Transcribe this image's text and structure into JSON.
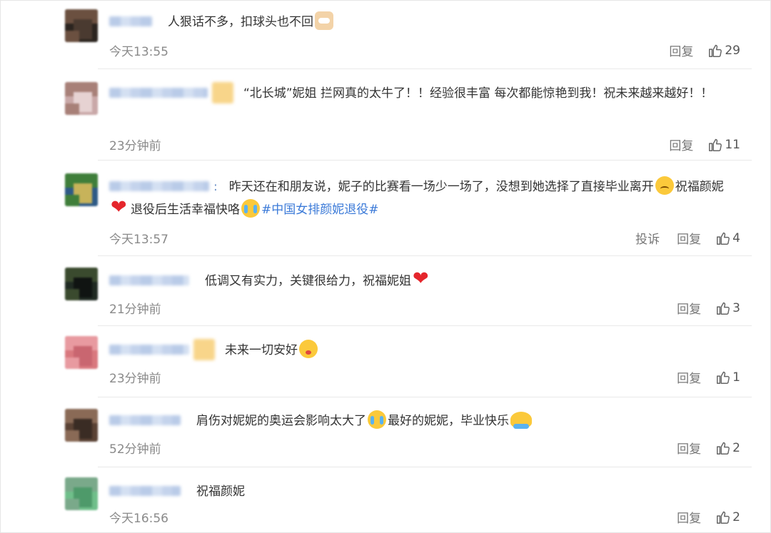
{
  "comments": [
    {
      "segments": [
        {
          "t": "人狠话不多，扣球头也不回"
        },
        {
          "emoji": "cat-face"
        }
      ],
      "badge": false,
      "colon": false,
      "time": "今天13:55",
      "report": null,
      "reply": "回复",
      "likes": "29",
      "avatar_colors": [
        "#2b241f",
        "#6b5040",
        "#4a3a30"
      ]
    },
    {
      "segments": [
        {
          "t": "“北长城”妮姐 拦网真的太牛了！！经验很丰富 每次都能惊艳到我！祝未来越来越好！！"
        }
      ],
      "badge": true,
      "colon": false,
      "time": "23分钟前",
      "report": null,
      "reply": "回复",
      "likes": "11",
      "avatar_colors": [
        "#c9a8a8",
        "#a88078",
        "#e6d2d2"
      ]
    },
    {
      "segments": [
        {
          "t": "昨天还在和朋友说，妮子的比赛看一场少一场了，没想到她选择了直接毕业离开"
        },
        {
          "emoji": "sweat-face"
        },
        {
          "t": "祝福颜妮"
        },
        {
          "emoji": "heart"
        },
        {
          "t": "退役后生活幸福快咯"
        },
        {
          "emoji": "crying-face"
        },
        {
          "topic": "#中国女排颜妮退役#"
        }
      ],
      "badge": false,
      "colon": true,
      "time": "今天13:57",
      "report": "投诉",
      "reply": "回复",
      "likes": "4",
      "avatar_colors": [
        "#2e5a86",
        "#3f7e3a",
        "#c7b35a"
      ]
    },
    {
      "segments": [
        {
          "t": "低调又有实力，关键很给力，祝福妮姐"
        },
        {
          "emoji": "heart"
        }
      ],
      "badge": false,
      "colon": false,
      "time": "21分钟前",
      "report": null,
      "reply": "回复",
      "likes": "3",
      "avatar_colors": [
        "#1f2a22",
        "#3a4a2e",
        "#101412"
      ]
    },
    {
      "segments": [
        {
          "t": "未来一切安好"
        },
        {
          "emoji": "kiss-face"
        }
      ],
      "badge": true,
      "colon": false,
      "time": "23分钟前",
      "report": null,
      "reply": "回复",
      "likes": "1",
      "avatar_colors": [
        "#d9787e",
        "#e89aa0",
        "#c96670"
      ]
    },
    {
      "segments": [
        {
          "t": "肩伤对妮妮的奥运会影响太大了"
        },
        {
          "emoji": "crying-face"
        },
        {
          "t": "最好的妮妮，毕业快乐"
        },
        {
          "emoji": "hug-face"
        }
      ],
      "badge": false,
      "colon": false,
      "time": "52分钟前",
      "report": null,
      "reply": "回复",
      "likes": "2",
      "avatar_colors": [
        "#5a4234",
        "#8a6a56",
        "#3a2c24"
      ]
    },
    {
      "segments": [
        {
          "t": "祝福颜妮"
        }
      ],
      "badge": false,
      "colon": false,
      "time": "今天16:56",
      "report": null,
      "reply": "回复",
      "likes": "2",
      "avatar_colors": [
        "#6fbf8a",
        "#7aa98a",
        "#4e9a6a"
      ]
    }
  ]
}
